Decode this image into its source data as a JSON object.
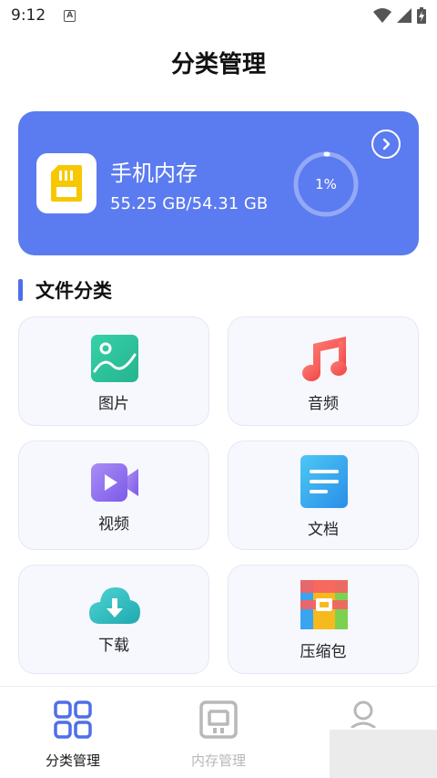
{
  "status_bar": {
    "time": "9:12",
    "notification_icon": "A"
  },
  "page_title": "分类管理",
  "storage_card": {
    "name": "手机内存",
    "size_text": "55.25 GB/54.31 GB",
    "percent_text": "1%",
    "progress": 0.01,
    "color": "#5b7bf0"
  },
  "section_title": "文件分类",
  "categories": [
    {
      "label": "图片",
      "icon": "image-icon"
    },
    {
      "label": "音频",
      "icon": "music-note-icon"
    },
    {
      "label": "视频",
      "icon": "video-camera-icon"
    },
    {
      "label": "文档",
      "icon": "document-icon"
    },
    {
      "label": "下载",
      "icon": "cloud-download-icon"
    },
    {
      "label": "压缩包",
      "icon": "archive-icon"
    }
  ],
  "bottom_nav": [
    {
      "label": "分类管理",
      "icon": "grid-icon",
      "active": true
    },
    {
      "label": "内存管理",
      "icon": "storage-icon",
      "active": false
    },
    {
      "label": "",
      "icon": "user-icon",
      "active": false
    }
  ],
  "colors": {
    "accent": "#4f6fe8",
    "inactive": "#b8b8b8"
  }
}
